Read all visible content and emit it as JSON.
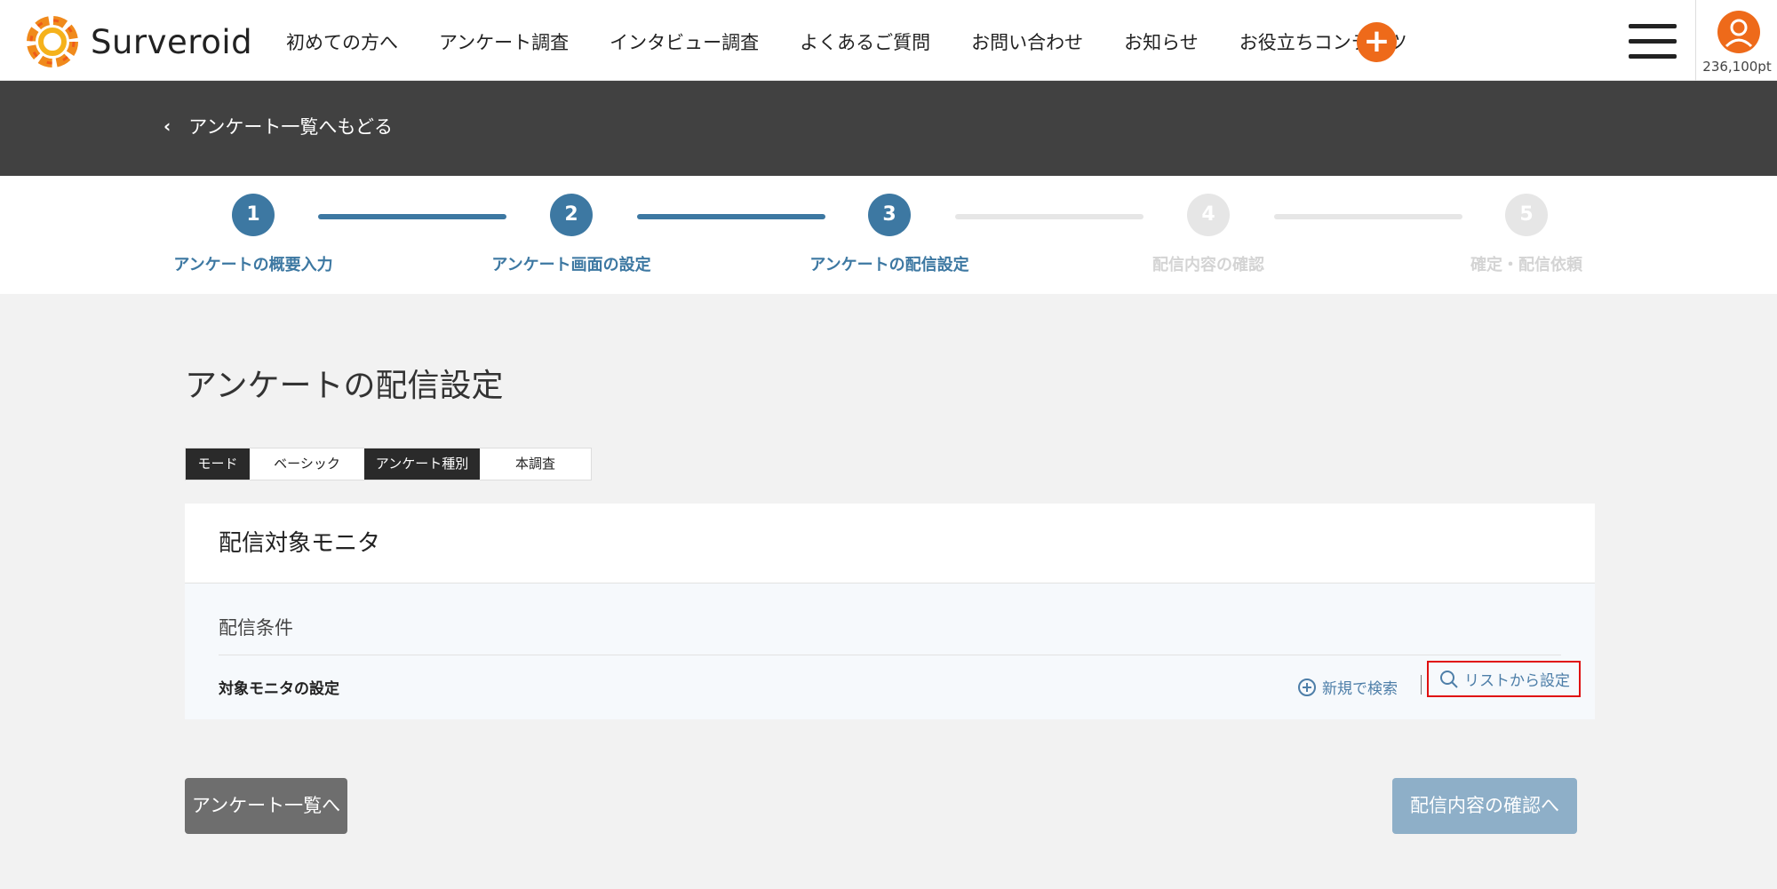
{
  "header": {
    "logo_text": "Surveroid",
    "nav": [
      "初めての方へ",
      "アンケート調査",
      "インタビュー調査",
      "よくあるご質問",
      "お問い合わせ",
      "お知らせ",
      "お役立ちコンテンツ"
    ],
    "plus_label": "+",
    "points": "236,100pt"
  },
  "backbar": {
    "back_label": "アンケート一覧へもどる"
  },
  "stepper": {
    "current_step": 3,
    "steps": [
      {
        "number": "1",
        "label": "アンケートの概要入力"
      },
      {
        "number": "2",
        "label": "アンケート画面の設定"
      },
      {
        "number": "3",
        "label": "アンケートの配信設定"
      },
      {
        "number": "4",
        "label": "配信内容の確認"
      },
      {
        "number": "5",
        "label": "確定・配信依頼"
      }
    ]
  },
  "main": {
    "title": "アンケートの配信設定",
    "mode_tabs": [
      {
        "label": "モード",
        "style": "dark"
      },
      {
        "label": "ベーシック",
        "style": "light"
      },
      {
        "label": "アンケート種別",
        "style": "dark"
      },
      {
        "label": "本調査",
        "style": "light"
      }
    ],
    "card": {
      "title": "配信対象モニタ",
      "condition_label": "配信条件",
      "target_label": "対象モニタの設定",
      "new_search_label": "新規で検索",
      "list_setting_label": "リストから設定"
    },
    "back_button": "アンケート一覧へ",
    "confirm_button": "配信内容の確認へ"
  },
  "colors": {
    "accent": "#ee6a1a",
    "step_active": "#3d78a2",
    "link": "#4d7ea8",
    "highlight": "#e01010"
  }
}
